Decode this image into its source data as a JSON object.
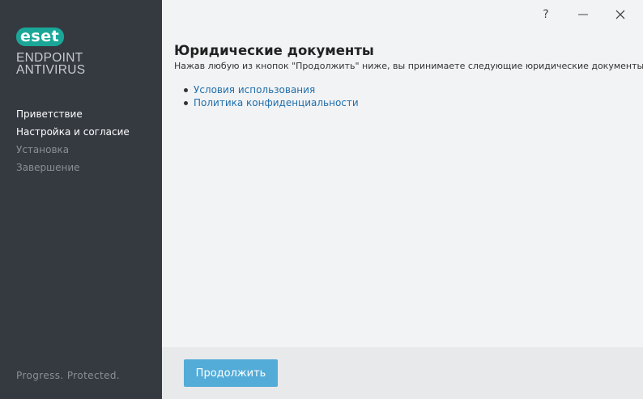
{
  "sidebar": {
    "logo_text": "eset",
    "product_line1": "ENDPOINT",
    "product_line2": "ANTIVIRUS",
    "steps": [
      {
        "label": "Приветствие",
        "state": "done"
      },
      {
        "label": "Настройка и согласие",
        "state": "current"
      },
      {
        "label": "Установка",
        "state": "pending"
      },
      {
        "label": "Завершение",
        "state": "pending"
      }
    ],
    "slogan": "Progress. Protected."
  },
  "titlebar": {
    "help_glyph": "?",
    "minimize_glyph": "—",
    "close_glyph": "✕"
  },
  "main": {
    "title": "Юридические документы",
    "subtitle": "Нажав любую из кнопок \"Продолжить\" ниже, вы принимаете следующие юридические документы:",
    "documents": [
      {
        "label": "Условия использования"
      },
      {
        "label": "Политика конфиденциальности"
      }
    ]
  },
  "footer": {
    "continue_label": "Продолжить"
  },
  "colors": {
    "sidebar_bg": "#353a41",
    "brand_teal": "#1ba798",
    "button_blue": "#53acd8",
    "link_blue": "#1f6fab"
  },
  "icons": {
    "help": "help-icon",
    "minimize": "minimize-icon",
    "close": "close-icon"
  }
}
